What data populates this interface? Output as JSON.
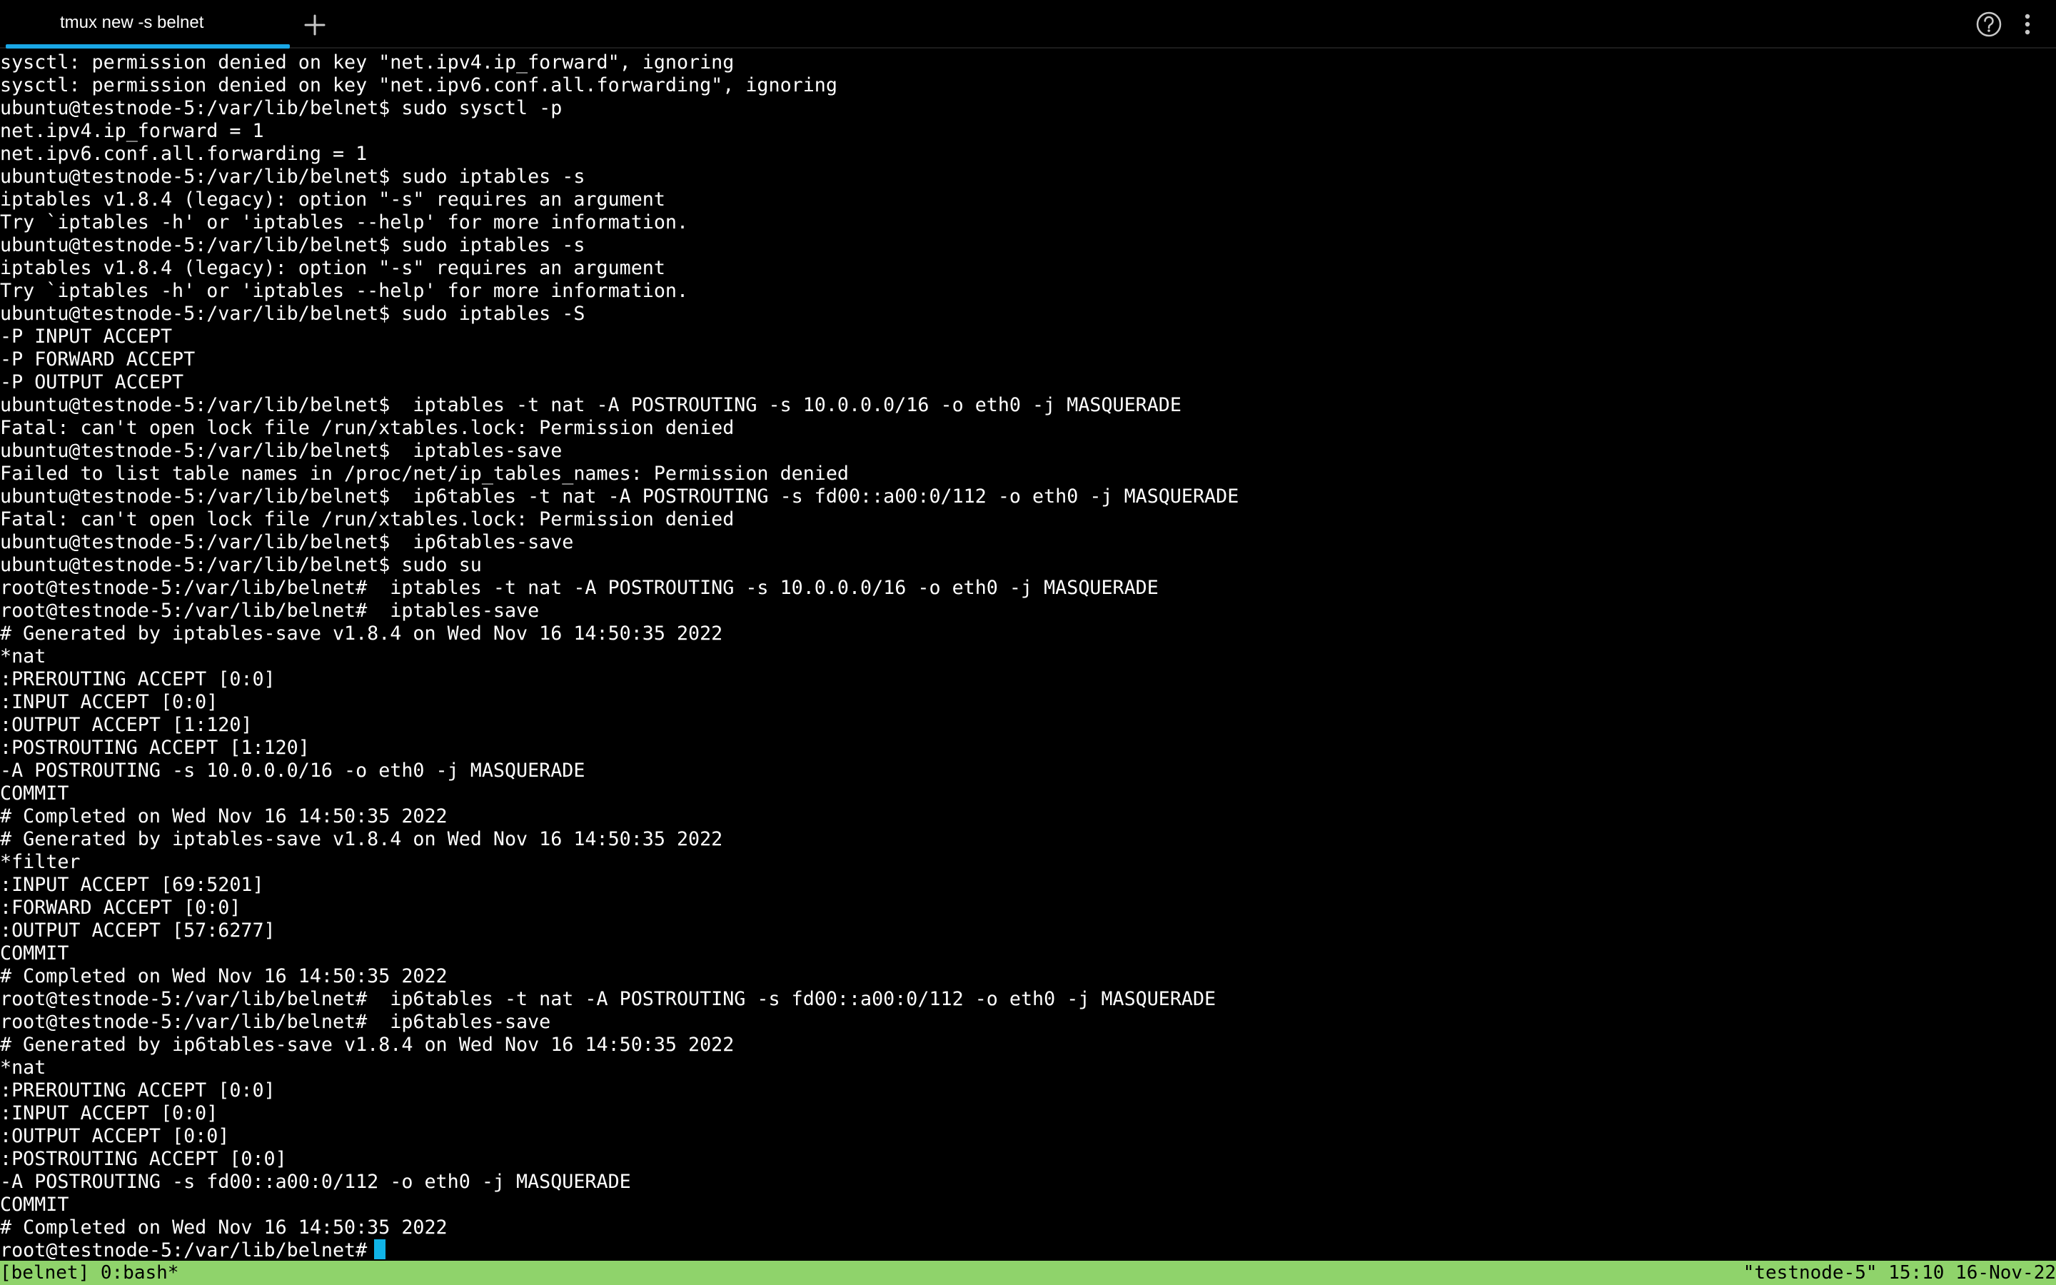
{
  "tab": {
    "title": "tmux new -s belnet"
  },
  "terminal": {
    "lines": [
      "sysctl: permission denied on key \"net.ipv4.ip_forward\", ignoring",
      "sysctl: permission denied on key \"net.ipv6.conf.all.forwarding\", ignoring",
      "ubuntu@testnode-5:/var/lib/belnet$ sudo sysctl -p",
      "net.ipv4.ip_forward = 1",
      "net.ipv6.conf.all.forwarding = 1",
      "ubuntu@testnode-5:/var/lib/belnet$ sudo iptables -s",
      "iptables v1.8.4 (legacy): option \"-s\" requires an argument",
      "Try `iptables -h' or 'iptables --help' for more information.",
      "ubuntu@testnode-5:/var/lib/belnet$ sudo iptables -s",
      "iptables v1.8.4 (legacy): option \"-s\" requires an argument",
      "Try `iptables -h' or 'iptables --help' for more information.",
      "ubuntu@testnode-5:/var/lib/belnet$ sudo iptables -S",
      "-P INPUT ACCEPT",
      "-P FORWARD ACCEPT",
      "-P OUTPUT ACCEPT",
      "ubuntu@testnode-5:/var/lib/belnet$  iptables -t nat -A POSTROUTING -s 10.0.0.0/16 -o eth0 -j MASQUERADE",
      "Fatal: can't open lock file /run/xtables.lock: Permission denied",
      "ubuntu@testnode-5:/var/lib/belnet$  iptables-save",
      "Failed to list table names in /proc/net/ip_tables_names: Permission denied",
      "ubuntu@testnode-5:/var/lib/belnet$  ip6tables -t nat -A POSTROUTING -s fd00::a00:0/112 -o eth0 -j MASQUERADE",
      "Fatal: can't open lock file /run/xtables.lock: Permission denied",
      "ubuntu@testnode-5:/var/lib/belnet$  ip6tables-save",
      "ubuntu@testnode-5:/var/lib/belnet$ sudo su",
      "root@testnode-5:/var/lib/belnet#  iptables -t nat -A POSTROUTING -s 10.0.0.0/16 -o eth0 -j MASQUERADE",
      "root@testnode-5:/var/lib/belnet#  iptables-save",
      "# Generated by iptables-save v1.8.4 on Wed Nov 16 14:50:35 2022",
      "*nat",
      ":PREROUTING ACCEPT [0:0]",
      ":INPUT ACCEPT [0:0]",
      ":OUTPUT ACCEPT [1:120]",
      ":POSTROUTING ACCEPT [1:120]",
      "-A POSTROUTING -s 10.0.0.0/16 -o eth0 -j MASQUERADE",
      "COMMIT",
      "# Completed on Wed Nov 16 14:50:35 2022",
      "# Generated by iptables-save v1.8.4 on Wed Nov 16 14:50:35 2022",
      "*filter",
      ":INPUT ACCEPT [69:5201]",
      ":FORWARD ACCEPT [0:0]",
      ":OUTPUT ACCEPT [57:6277]",
      "COMMIT",
      "# Completed on Wed Nov 16 14:50:35 2022",
      "root@testnode-5:/var/lib/belnet#  ip6tables -t nat -A POSTROUTING -s fd00::a00:0/112 -o eth0 -j MASQUERADE",
      "root@testnode-5:/var/lib/belnet#  ip6tables-save",
      "# Generated by ip6tables-save v1.8.4 on Wed Nov 16 14:50:35 2022",
      "*nat",
      ":PREROUTING ACCEPT [0:0]",
      ":INPUT ACCEPT [0:0]",
      ":OUTPUT ACCEPT [0:0]",
      ":POSTROUTING ACCEPT [0:0]",
      "-A POSTROUTING -s fd00::a00:0/112 -o eth0 -j MASQUERADE",
      "COMMIT",
      "# Completed on Wed Nov 16 14:50:35 2022"
    ],
    "prompt": "root@testnode-5:/var/lib/belnet#"
  },
  "status": {
    "left": "[belnet] 0:bash*",
    "right": "\"testnode-5\" 15:10 16-Nov-22"
  },
  "colors": {
    "background": "#000000",
    "foreground": "#ffffff",
    "accent": "#1aa7e6",
    "cursor": "#10b4e8",
    "status_bar": "#8fd36b"
  },
  "icons": {
    "new_tab": "plus-icon",
    "help": "help-circle-icon",
    "menu": "more-vertical-icon"
  }
}
